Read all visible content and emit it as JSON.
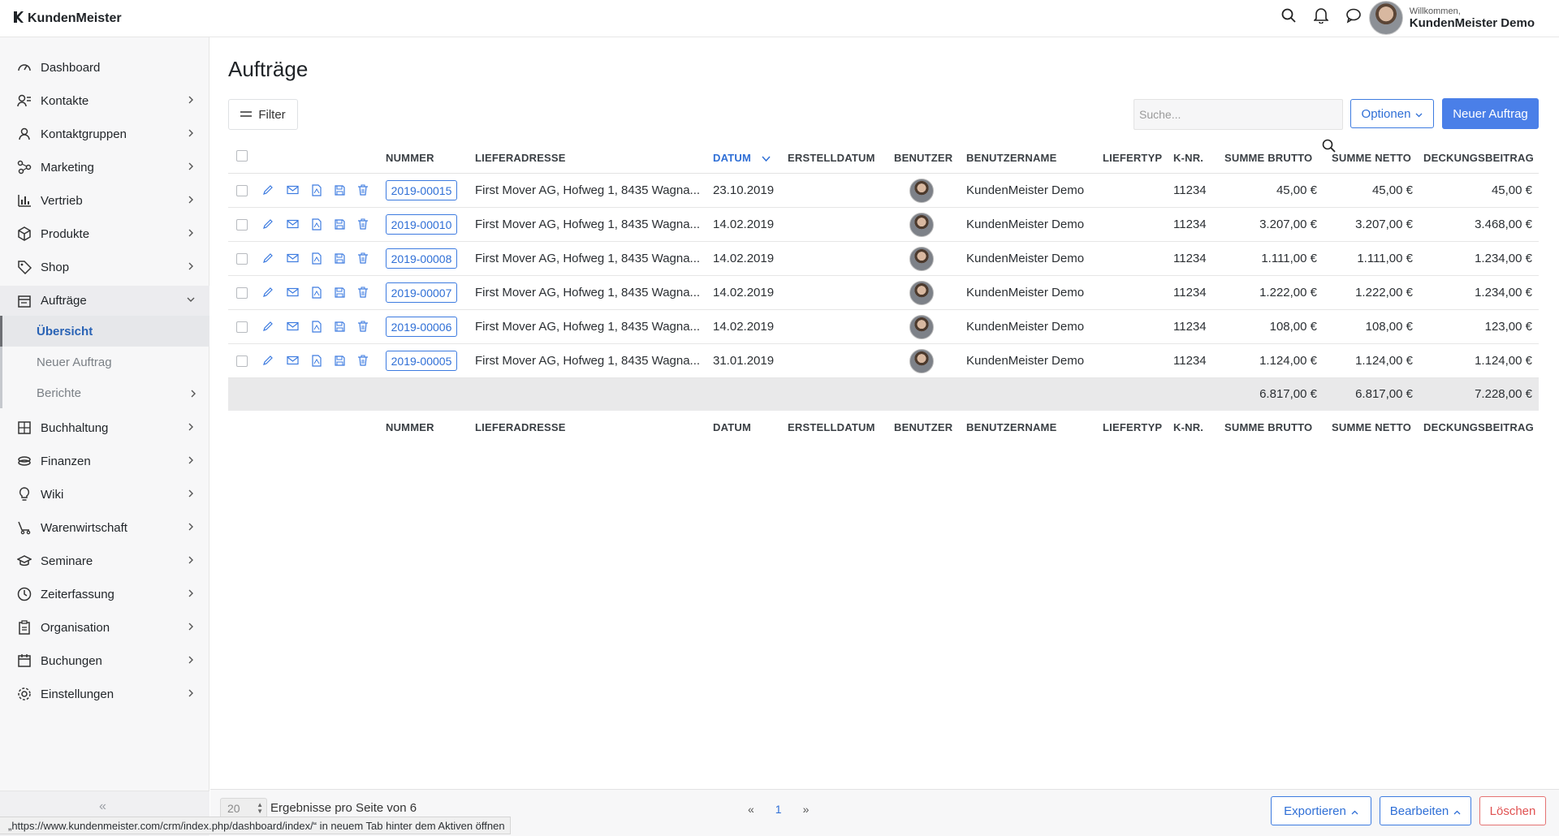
{
  "app": {
    "name": "KundenMeister"
  },
  "header": {
    "welcome": "Willkommen,",
    "user_name": "KundenMeister Demo",
    "icons": [
      "search-icon",
      "bell-icon",
      "chat-icon"
    ]
  },
  "sidebar": {
    "items": [
      {
        "label": "Dashboard",
        "icon": "dashboard-icon"
      },
      {
        "label": "Kontakte",
        "icon": "contacts-icon"
      },
      {
        "label": "Kontaktgruppen",
        "icon": "groups-icon"
      },
      {
        "label": "Marketing",
        "icon": "marketing-icon"
      },
      {
        "label": "Vertrieb",
        "icon": "sales-chart-icon"
      },
      {
        "label": "Produkte",
        "icon": "box-icon"
      },
      {
        "label": "Shop",
        "icon": "tag-icon"
      },
      {
        "label": "Aufträge",
        "icon": "orders-icon"
      },
      {
        "label": "Buchhaltung",
        "icon": "ledger-icon"
      },
      {
        "label": "Finanzen",
        "icon": "money-icon"
      },
      {
        "label": "Wiki",
        "icon": "bulb-icon"
      },
      {
        "label": "Warenwirtschaft",
        "icon": "cart-icon"
      },
      {
        "label": "Seminare",
        "icon": "graduation-icon"
      },
      {
        "label": "Zeiterfassung",
        "icon": "clock-icon"
      },
      {
        "label": "Organisation",
        "icon": "clipboard-icon"
      },
      {
        "label": "Buchungen",
        "icon": "calendar-icon"
      },
      {
        "label": "Einstellungen",
        "icon": "gear-icon"
      }
    ],
    "sub_items": [
      {
        "label": "Übersicht"
      },
      {
        "label": "Neuer Auftrag"
      },
      {
        "label": "Berichte"
      }
    ],
    "collapse_label": "«"
  },
  "page": {
    "title": "Aufträge",
    "filter_label": "Filter",
    "search_placeholder": "Suche...",
    "options_label": "Optionen",
    "new_label": "Neuer Auftrag"
  },
  "table": {
    "columns": {
      "nummer": "NUMMER",
      "lieferadresse": "LIEFERADRESSE",
      "datum": "DATUM",
      "erstelldatum": "ERSTELLDATUM",
      "benutzer": "BENUTZER",
      "benutzername": "BENUTZERNAME",
      "liefertyp": "LIEFERTYP",
      "knr": "K-NR.",
      "summe_brutto": "SUMME BRUTTO",
      "summe_netto": "SUMME NETTO",
      "deckungsbeitrag": "DECKUNGSBEITRAG"
    },
    "rows": [
      {
        "nummer": "2019-00015",
        "lieferadresse": "First Mover AG, Hofweg 1, 8435 Wagna...",
        "datum": "23.10.2019",
        "erstelldatum": "",
        "benutzername": "KundenMeister Demo",
        "liefertyp": "",
        "knr": "11234",
        "brutto": "45,00 €",
        "netto": "45,00 €",
        "deckung": "45,00 €"
      },
      {
        "nummer": "2019-00010",
        "lieferadresse": "First Mover AG, Hofweg 1, 8435 Wagna...",
        "datum": "14.02.2019",
        "erstelldatum": "",
        "benutzername": "KundenMeister Demo",
        "liefertyp": "",
        "knr": "11234",
        "brutto": "3.207,00 €",
        "netto": "3.207,00 €",
        "deckung": "3.468,00 €"
      },
      {
        "nummer": "2019-00008",
        "lieferadresse": "First Mover AG, Hofweg 1, 8435 Wagna...",
        "datum": "14.02.2019",
        "erstelldatum": "",
        "benutzername": "KundenMeister Demo",
        "liefertyp": "",
        "knr": "11234",
        "brutto": "1.111,00 €",
        "netto": "1.111,00 €",
        "deckung": "1.234,00 €"
      },
      {
        "nummer": "2019-00007",
        "lieferadresse": "First Mover AG, Hofweg 1, 8435 Wagna...",
        "datum": "14.02.2019",
        "erstelldatum": "",
        "benutzername": "KundenMeister Demo",
        "liefertyp": "",
        "knr": "11234",
        "brutto": "1.222,00 €",
        "netto": "1.222,00 €",
        "deckung": "1.234,00 €"
      },
      {
        "nummer": "2019-00006",
        "lieferadresse": "First Mover AG, Hofweg 1, 8435 Wagna...",
        "datum": "14.02.2019",
        "erstelldatum": "",
        "benutzername": "KundenMeister Demo",
        "liefertyp": "",
        "knr": "11234",
        "brutto": "108,00 €",
        "netto": "108,00 €",
        "deckung": "123,00 €"
      },
      {
        "nummer": "2019-00005",
        "lieferadresse": "First Mover AG, Hofweg 1, 8435 Wagna...",
        "datum": "31.01.2019",
        "erstelldatum": "",
        "benutzername": "KundenMeister Demo",
        "liefertyp": "",
        "knr": "11234",
        "brutto": "1.124,00 €",
        "netto": "1.124,00 €",
        "deckung": "1.124,00 €"
      }
    ],
    "totals": {
      "brutto": "6.817,00 €",
      "netto": "6.817,00 €",
      "deckung": "7.228,00 €"
    }
  },
  "footer": {
    "per_page": "20",
    "per_page_text": "Ergebnisse pro Seite von 6",
    "pager": {
      "prev": "«",
      "current": "1",
      "next": "»"
    },
    "export_label": "Exportieren",
    "edit_label": "Bearbeiten",
    "delete_label": "Löschen"
  },
  "status_bar": "„https://www.kundenmeister.com/crm/index.php/dashboard/index/“ in neuem Tab hinter dem Aktiven öffnen",
  "colors": {
    "accent": "#4a7fe8",
    "link": "#2f6fd6",
    "danger": "#e05252"
  }
}
